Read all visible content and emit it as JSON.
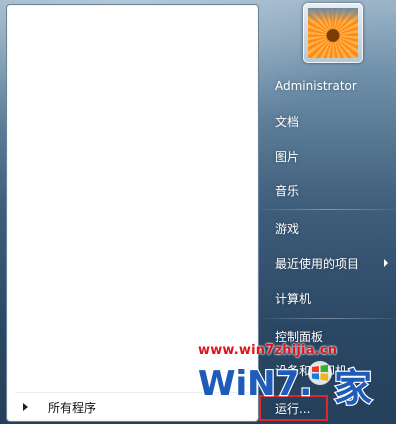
{
  "start_menu": {
    "left_pane": {
      "all_programs_label": "所有程序"
    },
    "user": {
      "name": "Administrator"
    },
    "right_items": [
      {
        "label": "文档",
        "has_submenu": false
      },
      {
        "label": "图片",
        "has_submenu": false
      },
      {
        "label": "音乐",
        "has_submenu": false
      },
      {
        "label": "游戏",
        "has_submenu": false
      },
      {
        "label": "最近使用的项目",
        "has_submenu": true
      },
      {
        "label": "计算机",
        "has_submenu": false
      },
      {
        "label": "控制面板",
        "has_submenu": false
      },
      {
        "label": "设备和打印机",
        "has_submenu": false
      },
      {
        "label": "运行...",
        "has_submenu": false
      }
    ],
    "highlighted_item": "运行..."
  },
  "watermark": {
    "url": "www.win7zhijia.cn",
    "logo_text": "WiN7.之家"
  },
  "colors": {
    "highlight_border": "#e0262a",
    "watermark_red": "#e0121a",
    "watermark_blue": "#1f5bb8"
  }
}
